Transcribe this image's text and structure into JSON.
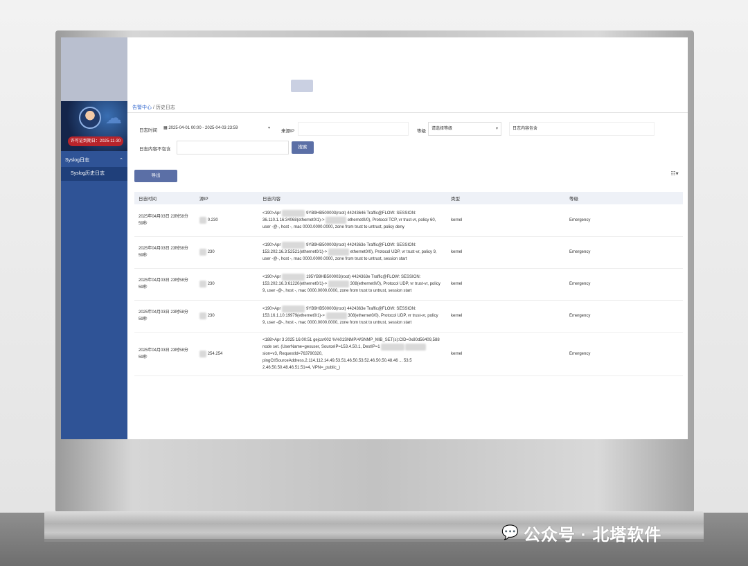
{
  "breadcrumb": {
    "home": "告警中心",
    "separator": "/",
    "current": "历史日志"
  },
  "license": "许可证到期日：2025-11-30",
  "sidebar": {
    "menu_parent": "Syslog日志",
    "menu_child": "Syslog历史日志"
  },
  "filters": {
    "time_label": "日志时间",
    "time_range": "2025-04-01 00:00 - 2025-04-03 23:59",
    "source_ip_label": "来源IP",
    "level_label": "等级",
    "level_placeholder": "请选择等级",
    "content_include_placeholder": "日志内容包含",
    "content_exclude_label": "日志内容不包含",
    "search_button": "搜索",
    "export_button": "导出"
  },
  "table": {
    "headers": [
      "日志时间",
      "源IP",
      "日志内容",
      "类型",
      "等级"
    ],
    "rows": [
      {
        "time": "2025年04月03日 23时58分59秒",
        "ip": "0.230",
        "content_pre": "<190>Apr",
        "content_mid": "9YB9HB500003(root) 44243646 Traffic@FLOW: SESSION: 36.110.1.16:34068(ethernet0/1)->",
        "content_post": "ethernet0/0), Protocol TCP, vr trust-vr, policy 60, user -@-, host -, mac 0000.0000.0000, zone from trust to untrust, policy deny",
        "type": "kernel",
        "level": "Emergency"
      },
      {
        "time": "2025年04月03日 23时58分59秒",
        "ip": "230",
        "content_pre": "<190>Apr",
        "content_mid": "9YB9HB500003(root) 4424363e Traffic@FLOW: SESSION: 153.202.16.3:52521(ethernet0/1)->",
        "content_post": "ethernet0/0), Protocol UDP, vr trust-vr, policy 9, user -@-, host -, mac 0000.0000.0000, zone from trust to untrust, session start",
        "type": "kernel",
        "level": "Emergency"
      },
      {
        "time": "2025年04月03日 23时58分59秒",
        "ip": "230",
        "content_pre": "<190>Apr",
        "content_mid": "195YB9HB500003(root) 4424363e Traffic@FLOW: SESSION: 153.202.16.3:61220(ethernet0/1)->",
        "content_post": "308(ethernet0/0), Protocol UDP, vr trust-vr, policy 9, user -@-, host -, mac 0000.0000.0000, zone from trust to untrust, session start",
        "type": "kernel",
        "level": "Emergency"
      },
      {
        "time": "2025年04月03日 23时58分59秒",
        "ip": "230",
        "content_pre": "<190>Apr",
        "content_mid": "9YB9HB500003(root) 4424363e Traffic@FLOW: SESSION: 153.16.1.10:19979(ethernet0/1)->",
        "content_post": "308(ethernet0/0), Protocol UDP, vr trust-vr, policy 9, user -@-, host -, mac 0000.0000.0000, zone from trust to untrust, session start",
        "type": "kernel",
        "level": "Emergency"
      },
      {
        "time": "2025年04月03日 23时58分59秒",
        "ip": "254.254",
        "content_pre": "<188>Apr 3 2025 16:00:51 gejcsr002 %%01SNMP/4/SNMP_MIB_SET(s):CID=0x80d56409,588 node set. (UserName=gexuser, SourceIP=153.4.50.1, DestIP=1",
        "content_mid": "",
        "content_post": "sion=v3, RequestId=763790320, pingCtlSourceAddress.2.114.112.14.49.53.51.46.50.53.52.46.50.50.48.46 ... 53.5 2.46.50.50.48.46.51.51=4, VPN=_public_)",
        "type": "kernel",
        "level": "Emergency"
      }
    ]
  },
  "watermark_caption": "公众号 · 北塔软件",
  "colors": {
    "sidebar": "#2f5396",
    "sidebar_active": "#1f3f7a",
    "button": "#5b6fa6",
    "license_badge": "#b8242b",
    "link": "#3d6fd1"
  }
}
